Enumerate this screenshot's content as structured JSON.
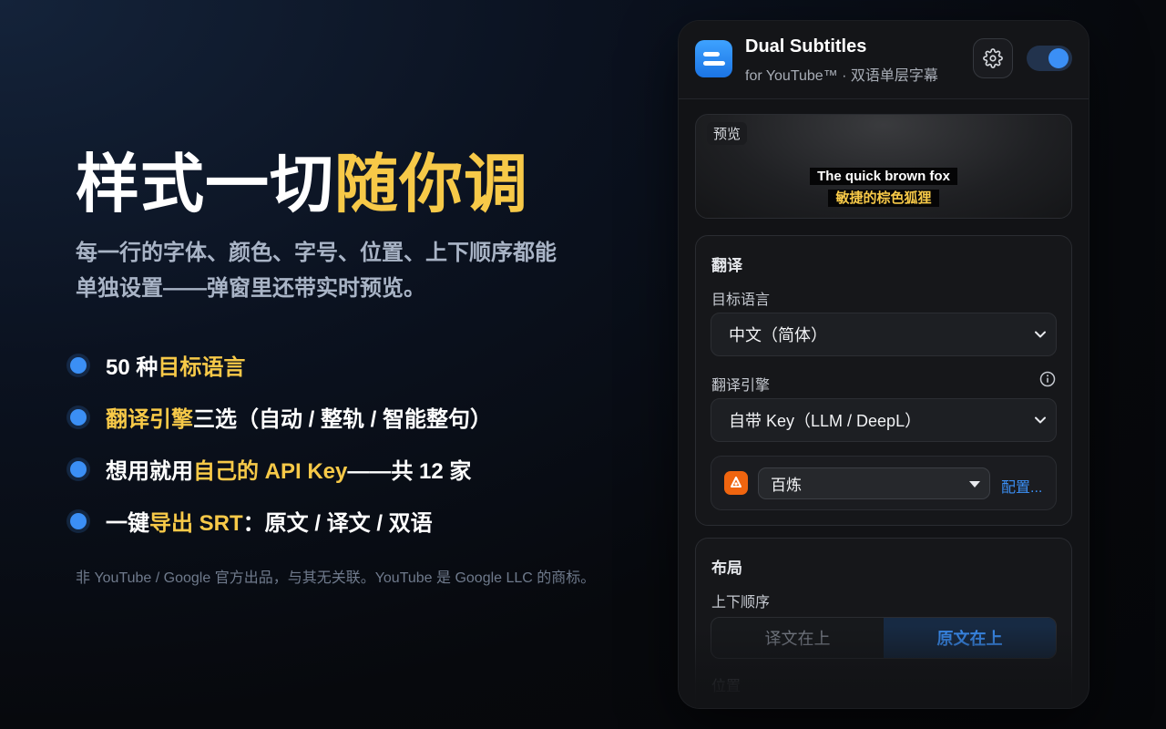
{
  "promo": {
    "headline_plain": "样式一切",
    "headline_highlight": "随你调",
    "sub_line1": "每一行的字体、颜色、字号、位置、上下顺序都能",
    "sub_line2": "单独设置——弹窗里还带实时预览。",
    "features": [
      {
        "pre": "50 种",
        "hl": "目标语言",
        "post": ""
      },
      {
        "pre": "",
        "hl": "翻译引擎",
        "post": "三选（自动 / 整轨 / 智能整句）"
      },
      {
        "pre": "想用就用",
        "hl": "自己的 API Key",
        "post": "——共 12 家"
      },
      {
        "pre": "一键",
        "hl": "导出 SRT",
        "post": "：原文 / 译文 / 双语"
      }
    ],
    "disclaimer": "非 YouTube / Google 官方出品，与其无关联。YouTube 是 Google LLC 的商标。",
    "highlight_color": "#f7c948",
    "accent_color": "#3b8ff5"
  },
  "popup": {
    "app_title": "Dual Subtitles",
    "app_subtitle": "for YouTube™ · 双语单层字幕",
    "settings_icon": "gear-icon",
    "enabled": true,
    "preview": {
      "tag": "预览",
      "line1": "The quick brown fox",
      "line2": "敏捷的棕色狐狸"
    },
    "translation": {
      "section_title": "翻译",
      "target_label": "目标语言",
      "target_value": "中文（简体）",
      "engine_label": "翻译引擎",
      "engine_value": "自带 Key（LLM / DeepL）",
      "provider_value": "百炼",
      "config_link": "配置..."
    },
    "layout": {
      "section_title": "布局",
      "order_label": "上下顺序",
      "order_options": [
        "译文在上",
        "原文在上"
      ],
      "order_selected": "原文在上",
      "position_label": "位置"
    }
  }
}
